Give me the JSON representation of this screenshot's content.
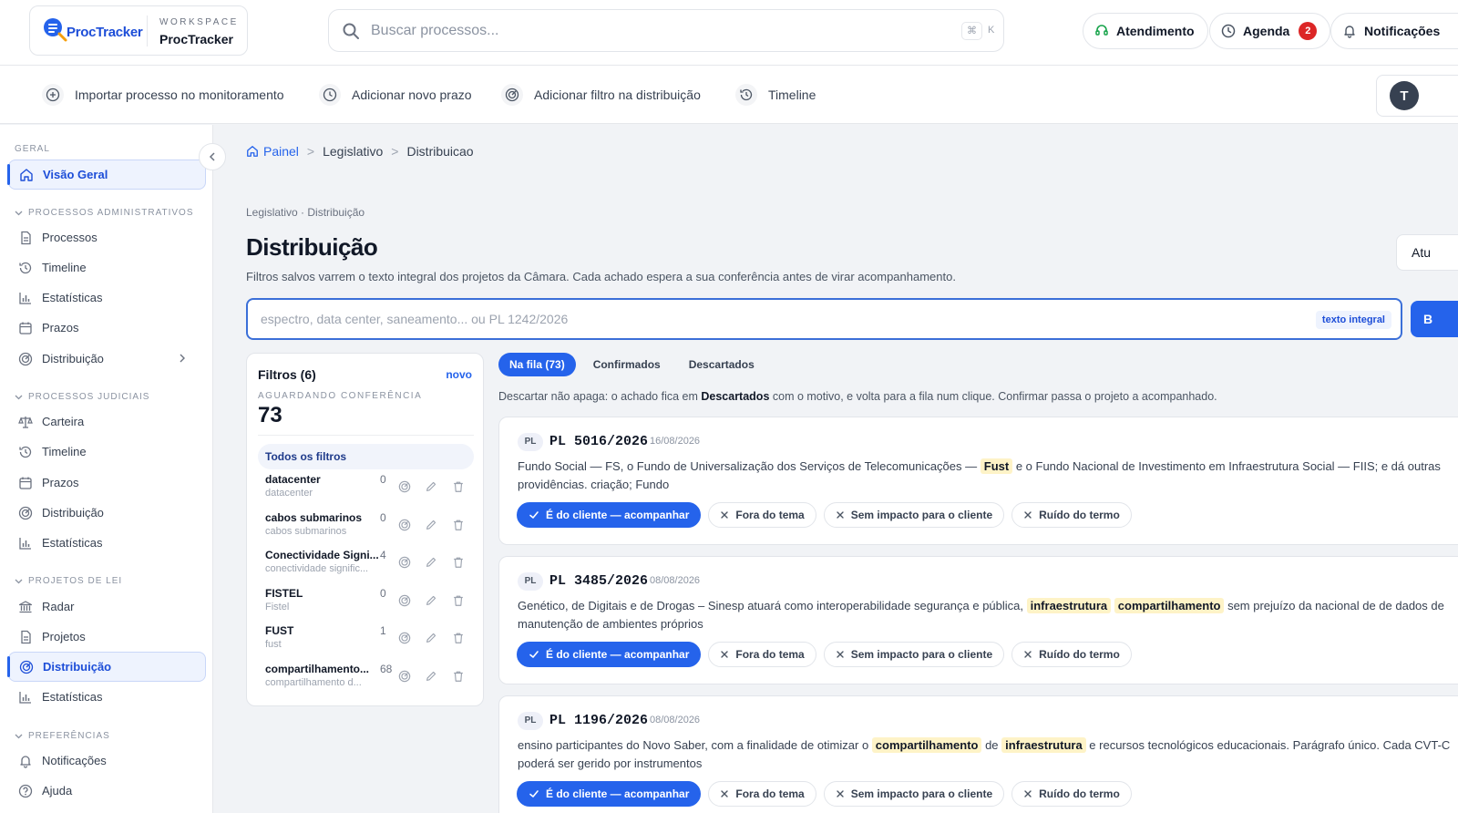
{
  "brand": {
    "logo_text": "ProcTracker",
    "workspace_label": "WORKSPACE",
    "workspace_name": "ProcTracker"
  },
  "search": {
    "placeholder": "Buscar processos...",
    "kbd_cmd": "⌘",
    "kbd_k": "K"
  },
  "header": {
    "support_label": "Atendimento",
    "agenda_label": "Agenda",
    "agenda_badge": "2",
    "notifications_label": "Notificações"
  },
  "actions": [
    {
      "label": "Importar processo no monitoramento",
      "icon": "plus-circle-icon"
    },
    {
      "label": "Adicionar novo prazo",
      "icon": "clock-icon"
    },
    {
      "label": "Adicionar filtro na distribuição",
      "icon": "radar-icon"
    },
    {
      "label": "Timeline",
      "icon": "history-icon"
    }
  ],
  "user": {
    "initial": "T"
  },
  "sidebar": {
    "geral_label": "GERAL",
    "visao_geral": "Visão Geral",
    "admin_label": "PROCESSOS ADMINISTRATIVOS",
    "admin_items": [
      "Processos",
      "Timeline",
      "Estatísticas",
      "Prazos",
      "Distribuição"
    ],
    "judicial_label": "PROCESSOS JUDICIAIS",
    "judicial_items": [
      "Carteira",
      "Timeline",
      "Prazos",
      "Distribuição",
      "Estatísticas"
    ],
    "lei_label": "PROJETOS DE LEI",
    "lei_items": [
      "Radar",
      "Projetos",
      "Distribuição",
      "Estatísticas"
    ],
    "pref_label": "PREFERÊNCIAS",
    "pref_items": [
      "Notificações",
      "Ajuda"
    ]
  },
  "breadcrumb": {
    "home": "Painel",
    "section": "Legislativo",
    "current": "Distribuicao"
  },
  "page": {
    "eyebrow": "Legislativo · Distribuição",
    "title": "Distribuição",
    "subtitle": "Filtros salvos varrem o texto integral dos projetos da Câmara. Cada achado espera a sua conferência antes de virar acompanhamento.",
    "update_button": "Atu",
    "search_placeholder": "espectro, data center, saneamento... ou PL 1242/2026",
    "search_tag": "texto integral",
    "search_button": "B"
  },
  "filters": {
    "title": "Filtros (6)",
    "new_label": "novo",
    "waiting_label": "AGUARDANDO CONFERÊNCIA",
    "waiting_count": "73",
    "all_label": "Todos os filtros",
    "items": [
      {
        "name": "datacenter",
        "sub": "datacenter",
        "count": "0"
      },
      {
        "name": "cabos submarinos",
        "sub": "cabos submarinos",
        "count": "0"
      },
      {
        "name": "Conectividade Signi...",
        "sub": "conectividade signific...",
        "count": "4"
      },
      {
        "name": "FISTEL",
        "sub": "Fistel",
        "count": "0"
      },
      {
        "name": "FUST",
        "sub": "fust",
        "count": "1"
      },
      {
        "name": "compartilhamento...",
        "sub": "compartilhamento d...",
        "count": "68"
      }
    ]
  },
  "tabs": [
    "Na fila (73)",
    "Confirmados",
    "Descartados"
  ],
  "hint": {
    "before": "Descartar não apaga: o achado fica em ",
    "bold": "Descartados",
    "after": " com o motivo, e volta para a fila num clique. Confirmar passa o projeto a acompanhado."
  },
  "card_buttons": {
    "confirm": "É do cliente — acompanhar",
    "off_topic": "Fora do tema",
    "no_impact": "Sem impacto para o cliente",
    "noise": "Ruído do termo"
  },
  "cards": [
    {
      "tag": "PL",
      "number": "PL 5016/2026",
      "date": "16/08/2026",
      "line1": [
        {
          "t": "Fundo Social — FS, o Fundo de Universalização dos Serviços de Telecomunicações — "
        },
        {
          "t": "Fust",
          "hl": true
        },
        {
          "t": " e o Fundo Nacional de Investimento em Infraestrutura Social — FIIS; e dá outras"
        }
      ],
      "line2": "providências. criação; Fundo"
    },
    {
      "tag": "PL",
      "number": "PL 3485/2026",
      "date": "08/08/2026",
      "line1": [
        {
          "t": "Genético, de Digitais e de Drogas – Sinesp atuará como interoperabilidade segurança e pública, "
        },
        {
          "t": "infraestrutura",
          "hl": true
        },
        {
          "t": " "
        },
        {
          "t": "compartilhamento",
          "hl": true
        },
        {
          "t": " sem prejuízo da nacional de de dados de"
        }
      ],
      "line2": "manutenção de ambientes próprios"
    },
    {
      "tag": "PL",
      "number": "PL 1196/2026",
      "date": "08/08/2026",
      "line1": [
        {
          "t": "ensino participantes do Novo Saber, com a finalidade de otimizar o "
        },
        {
          "t": "compartilhamento",
          "hl": true
        },
        {
          "t": " de "
        },
        {
          "t": "infraestrutura",
          "hl": true
        },
        {
          "t": " e recursos tecnológicos educacionais. Parágrafo único. Cada CVT-C"
        }
      ],
      "line2": "poderá ser gerido por instrumentos"
    }
  ],
  "colors": {
    "accent": "#2563eb",
    "highlight": "#fef3c7",
    "badge": "#dc2626"
  }
}
